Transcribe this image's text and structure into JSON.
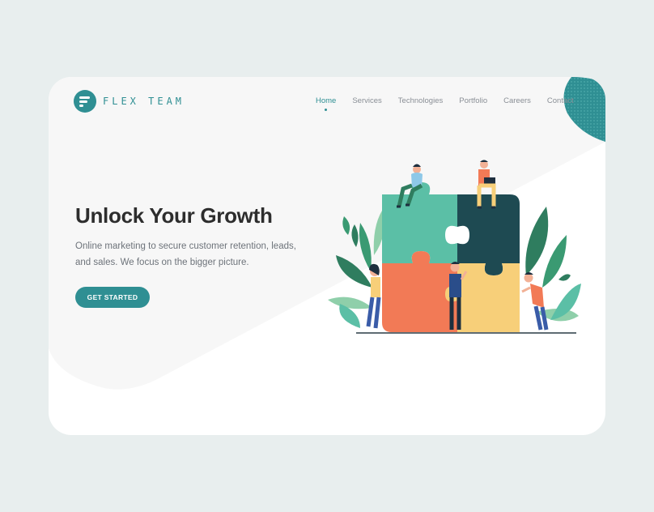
{
  "brand": {
    "name": "FLEX TEAM",
    "color": "#2f8f93"
  },
  "nav": {
    "items": [
      {
        "label": "Home",
        "active": true
      },
      {
        "label": "Services",
        "active": false
      },
      {
        "label": "Technologies",
        "active": false
      },
      {
        "label": "Portfolio",
        "active": false
      },
      {
        "label": "Careers",
        "active": false
      },
      {
        "label": "Contact",
        "active": false
      }
    ]
  },
  "hero": {
    "title": "Unlock Your Growth",
    "description": "Online marketing to secure customer retention, leads, and sales. We focus on the bigger picture.",
    "cta_label": "GET STARTED"
  },
  "illustration": {
    "subject": "team-assembling-puzzle",
    "colors": {
      "teal_piece": "#5bbfa6",
      "dark_piece": "#1e4a52",
      "orange_piece": "#f27a56",
      "yellow_piece": "#f7cf79",
      "leaf_dark": "#2f7d5f",
      "leaf_light": "#8fcfaa"
    }
  }
}
